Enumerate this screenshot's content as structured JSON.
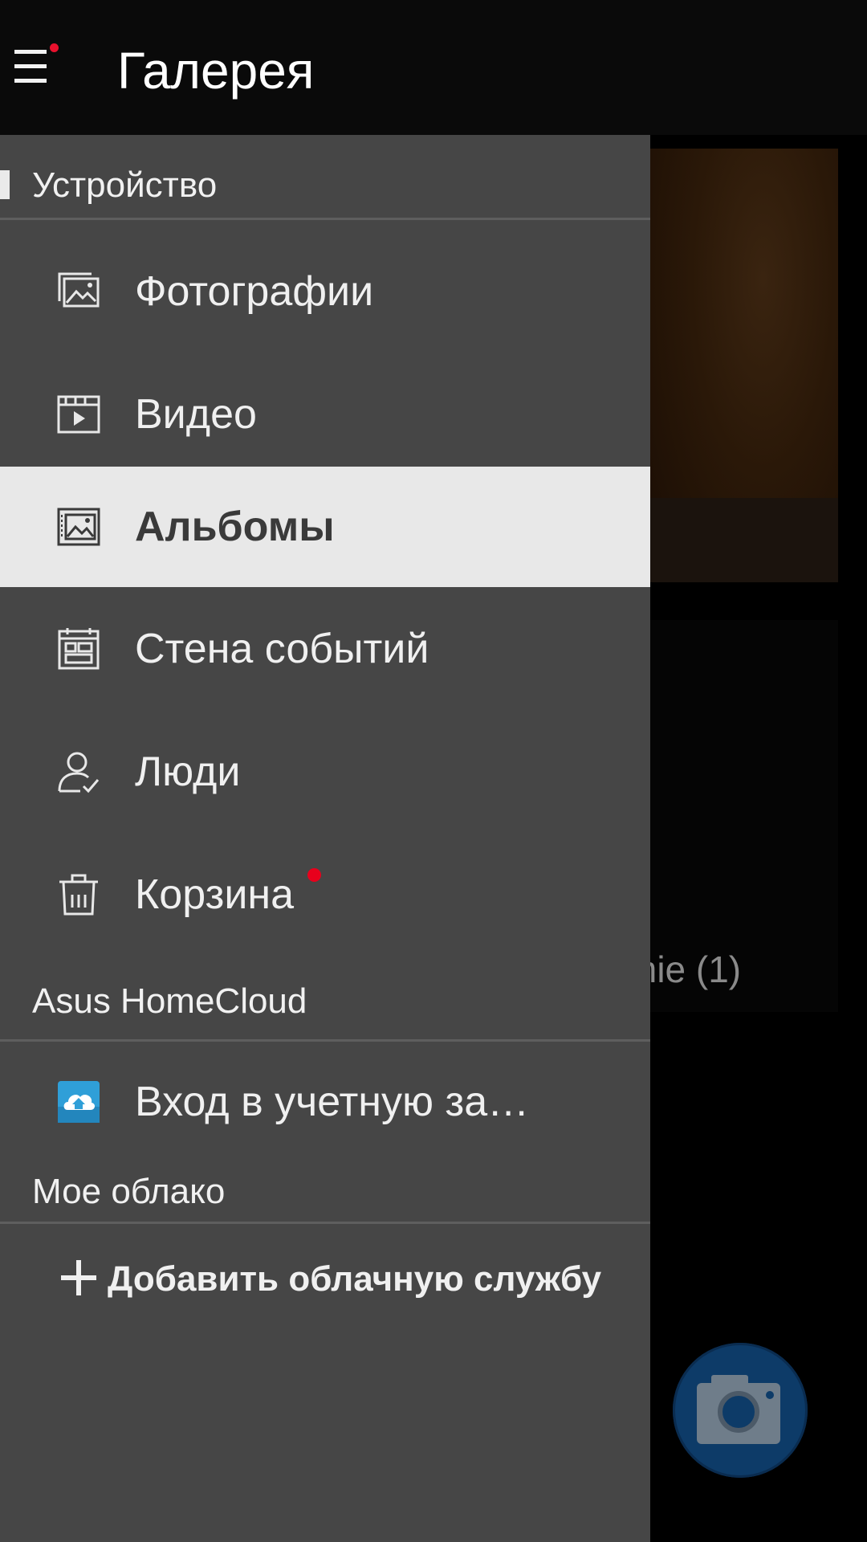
{
  "app_bar": {
    "title": "Галерея",
    "menu_icon": "hamburger-menu-icon",
    "notification_dot_color": "#e8112d"
  },
  "drawer": {
    "sections": [
      {
        "title": "Устройство",
        "items": [
          {
            "label": "Фотографии",
            "icon": "photos-icon",
            "selected": false
          },
          {
            "label": "Видео",
            "icon": "video-icon",
            "selected": false
          },
          {
            "label": "Альбомы",
            "icon": "albums-icon",
            "selected": true
          },
          {
            "label": "Стена событий",
            "icon": "event-wall-icon",
            "selected": false
          },
          {
            "label": "Люди",
            "icon": "people-icon",
            "selected": false
          },
          {
            "label": "Корзина",
            "icon": "trash-icon",
            "selected": false,
            "badge": true
          }
        ]
      },
      {
        "title": "Asus HomeCloud",
        "items": [
          {
            "label": "Вход в учетную за…",
            "icon": "homecloud-icon"
          }
        ]
      },
      {
        "title": "Мое облако",
        "action": "Добавить облачную службу"
      }
    ]
  },
  "background": {
    "album_label_partial": "mie (1)",
    "camera_fab_icon": "camera-icon"
  },
  "colors": {
    "drawer_bg": "#464646",
    "selected_bg": "#e8e8e8",
    "badge": "#e8001c",
    "fab": "#0d3b68"
  }
}
